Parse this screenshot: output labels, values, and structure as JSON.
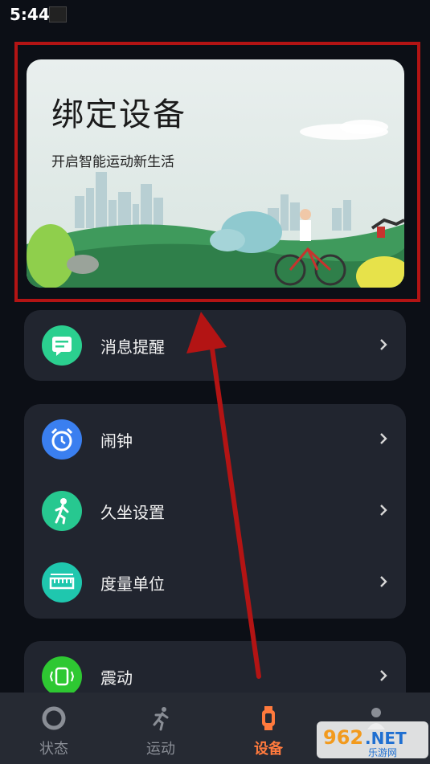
{
  "status_bar": {
    "time": "5:44"
  },
  "banner": {
    "title": "绑定设备",
    "subtitle": "开启智能运动新生活"
  },
  "menu_groups": [
    {
      "items": [
        {
          "label": "消息提醒",
          "icon": "message-icon",
          "color": "#2bcf8f"
        }
      ]
    },
    {
      "items": [
        {
          "label": "闹钟",
          "icon": "alarm-clock-icon",
          "color": "#3a7ff0"
        },
        {
          "label": "久坐设置",
          "icon": "sedentary-person-icon",
          "color": "#27c890"
        },
        {
          "label": "度量单位",
          "icon": "ruler-icon",
          "color": "#1fc7ae"
        }
      ]
    },
    {
      "items": [
        {
          "label": "震动",
          "icon": "vibration-watch-icon",
          "color": "#2ec832"
        }
      ]
    }
  ],
  "bottom_nav": {
    "items": [
      {
        "label": "状态",
        "icon": "status-ring-icon",
        "active": false
      },
      {
        "label": "运动",
        "icon": "running-icon",
        "active": false
      },
      {
        "label": "设备",
        "icon": "watch-icon",
        "active": true
      },
      {
        "label": "",
        "icon": "profile-icon",
        "active": false
      }
    ]
  },
  "watermark": {
    "text": "962.NET",
    "subtext": "乐游网"
  },
  "colors": {
    "accent": "#ff7a3d",
    "highlight_frame": "#b31414",
    "card_bg": "#21252f",
    "background": "#0c0f16"
  }
}
